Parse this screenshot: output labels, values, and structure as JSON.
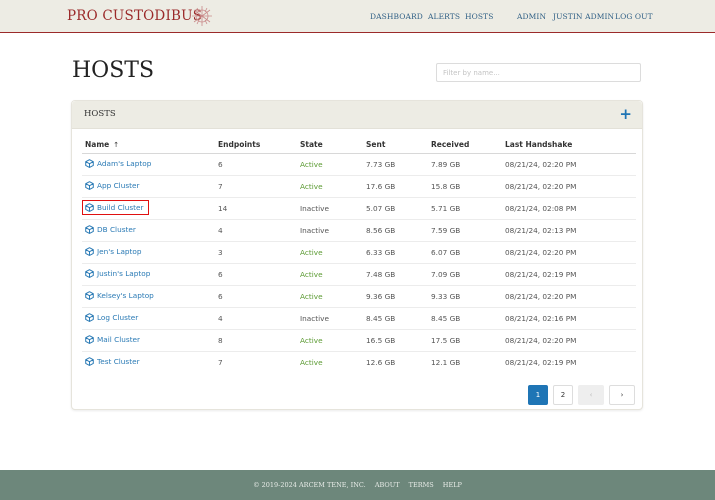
{
  "header": {
    "brand": "PRO CUSTODIBUS",
    "nav": [
      "DASHBOARD",
      "ALERTS",
      "HOSTS"
    ],
    "user_nav": [
      "ADMIN",
      "JUSTIN ADMIN",
      "LOG OUT"
    ]
  },
  "page": {
    "title": "HOSTS",
    "filter_placeholder": "Filter by name..."
  },
  "panel": {
    "title": "HOSTS",
    "add_icon": "+",
    "columns": [
      "Name",
      "Endpoints",
      "State",
      "Sent",
      "Received",
      "Last Handshake"
    ],
    "sort_indicator": "↑",
    "rows": [
      {
        "name": "Adam's Laptop",
        "endpoints": "6",
        "state": "Active",
        "sent": "7.73 GB",
        "received": "7.89 GB",
        "handshake": "08/21/24, 02:20 PM"
      },
      {
        "name": "App Cluster",
        "endpoints": "7",
        "state": "Active",
        "sent": "17.6 GB",
        "received": "15.8 GB",
        "handshake": "08/21/24, 02:20 PM"
      },
      {
        "name": "Build Cluster",
        "endpoints": "14",
        "state": "Inactive",
        "sent": "5.07 GB",
        "received": "5.71 GB",
        "handshake": "08/21/24, 02:08 PM"
      },
      {
        "name": "DB Cluster",
        "endpoints": "4",
        "state": "Inactive",
        "sent": "8.56 GB",
        "received": "7.59 GB",
        "handshake": "08/21/24, 02:13 PM"
      },
      {
        "name": "Jen's Laptop",
        "endpoints": "3",
        "state": "Active",
        "sent": "6.33 GB",
        "received": "6.07 GB",
        "handshake": "08/21/24, 02:20 PM"
      },
      {
        "name": "Justin's Laptop",
        "endpoints": "6",
        "state": "Active",
        "sent": "7.48 GB",
        "received": "7.09 GB",
        "handshake": "08/21/24, 02:19 PM"
      },
      {
        "name": "Kelsey's Laptop",
        "endpoints": "6",
        "state": "Active",
        "sent": "9.36 GB",
        "received": "9.33 GB",
        "handshake": "08/21/24, 02:20 PM"
      },
      {
        "name": "Log Cluster",
        "endpoints": "4",
        "state": "Inactive",
        "sent": "8.45 GB",
        "received": "8.45 GB",
        "handshake": "08/21/24, 02:16 PM"
      },
      {
        "name": "Mail Cluster",
        "endpoints": "8",
        "state": "Active",
        "sent": "16.5 GB",
        "received": "17.5 GB",
        "handshake": "08/21/24, 02:20 PM"
      },
      {
        "name": "Test Cluster",
        "endpoints": "7",
        "state": "Active",
        "sent": "12.6 GB",
        "received": "12.1 GB",
        "handshake": "08/21/24, 02:19 PM"
      }
    ],
    "highlighted_row": 2,
    "pagination": {
      "pages": [
        "1",
        "2"
      ],
      "current": "1",
      "prev": "‹",
      "next": "›"
    }
  },
  "footer": {
    "copyright": "© 2019-2024 ARCEM TENE, INC.",
    "links": [
      "ABOUT",
      "TERMS",
      "HELP"
    ]
  },
  "colors": {
    "brand": "#9b2a2a",
    "link": "#2a7ab5",
    "active": "#5b9a32",
    "footer": "#6d877b"
  }
}
